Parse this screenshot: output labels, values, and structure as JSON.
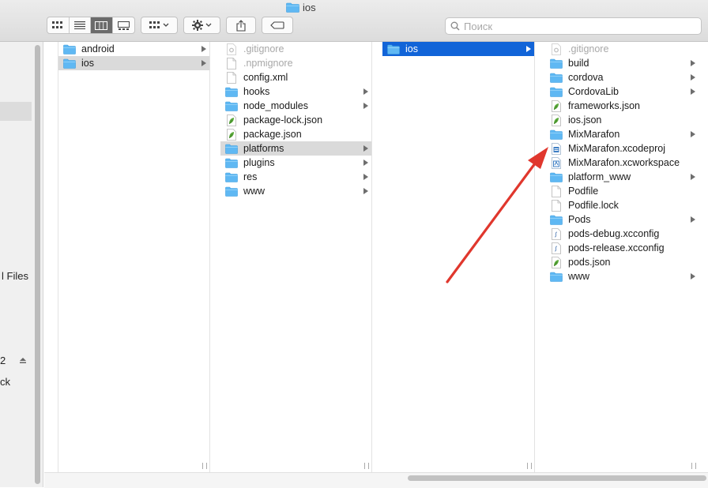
{
  "window": {
    "title": "ios"
  },
  "toolbar": {
    "view_buttons": [
      {
        "name": "icon-view-button",
        "icon": "icon-view-icon"
      },
      {
        "name": "list-view-button",
        "icon": "list-view-icon"
      },
      {
        "name": "column-view-button",
        "icon": "column-view-icon",
        "active": true
      },
      {
        "name": "gallery-view-button",
        "icon": "gallery-view-icon"
      }
    ],
    "group_button_icon": "group-icon",
    "action_button_icon": "gear-icon",
    "share_button_icon": "share-icon",
    "tags_button_icon": "tag-icon"
  },
  "search": {
    "placeholder": "Поиск",
    "value": ""
  },
  "sidebar": {
    "texts": [
      "l Files",
      "2",
      "ck"
    ]
  },
  "columns": [
    {
      "items": [
        {
          "label": "android",
          "type": "folder",
          "chevron": true
        },
        {
          "label": "ios",
          "type": "folder",
          "chevron": true,
          "selected": "gray"
        }
      ]
    },
    {
      "items": [
        {
          "label": ".gitignore",
          "type": "gear-doc",
          "hidden": true
        },
        {
          "label": ".npmignore",
          "type": "doc",
          "hidden": true
        },
        {
          "label": "config.xml",
          "type": "doc"
        },
        {
          "label": "hooks",
          "type": "folder",
          "chevron": true
        },
        {
          "label": "node_modules",
          "type": "folder",
          "chevron": true
        },
        {
          "label": "package-lock.json",
          "type": "json"
        },
        {
          "label": "package.json",
          "type": "json"
        },
        {
          "label": "platforms",
          "type": "folder",
          "chevron": true,
          "selected": "gray"
        },
        {
          "label": "plugins",
          "type": "folder",
          "chevron": true
        },
        {
          "label": "res",
          "type": "folder",
          "chevron": true
        },
        {
          "label": "www",
          "type": "folder",
          "chevron": true
        }
      ]
    },
    {
      "items": [
        {
          "label": "ios",
          "type": "folder",
          "chevron": true,
          "selected": "blue"
        }
      ]
    },
    {
      "items": [
        {
          "label": ".gitignore",
          "type": "gear-doc",
          "hidden": true
        },
        {
          "label": "build",
          "type": "folder",
          "chevron": true
        },
        {
          "label": "cordova",
          "type": "folder",
          "chevron": true
        },
        {
          "label": "CordovaLib",
          "type": "folder",
          "chevron": true
        },
        {
          "label": "frameworks.json",
          "type": "json"
        },
        {
          "label": "ios.json",
          "type": "json"
        },
        {
          "label": "MixMarafon",
          "type": "folder",
          "chevron": true
        },
        {
          "label": "MixMarafon.xcodeproj",
          "type": "xcodeproj"
        },
        {
          "label": "MixMarafon.xcworkspace",
          "type": "xcworkspace"
        },
        {
          "label": "platform_www",
          "type": "folder",
          "chevron": true
        },
        {
          "label": "Podfile",
          "type": "doc"
        },
        {
          "label": "Podfile.lock",
          "type": "doc"
        },
        {
          "label": "Pods",
          "type": "folder",
          "chevron": true
        },
        {
          "label": "pods-debug.xcconfig",
          "type": "xcconfig"
        },
        {
          "label": "pods-release.xcconfig",
          "type": "xcconfig"
        },
        {
          "label": "pods.json",
          "type": "json"
        },
        {
          "label": "www",
          "type": "folder",
          "chevron": true
        }
      ]
    }
  ],
  "colors": {
    "selection_blue": "#1164d8",
    "selection_gray": "#dadada",
    "folder_blue": "#5fb8f3",
    "annotation_arrow": "#e0372d"
  }
}
